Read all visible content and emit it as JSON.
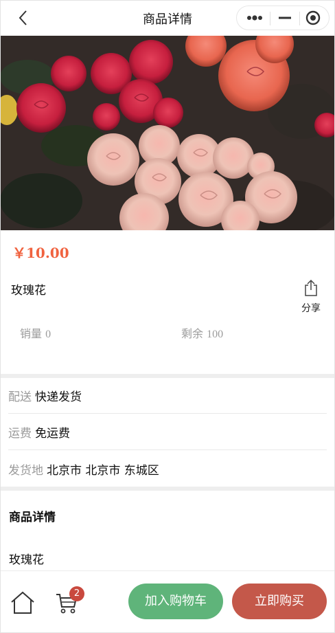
{
  "header": {
    "title": "商品详情",
    "icons": [
      "back-arrow-icon",
      "more-dots-icon",
      "minimize-icon",
      "target-close-icon"
    ]
  },
  "product": {
    "image_icon": "rose-bouquet-photo",
    "price": "￥10.00",
    "name": "玫瑰花",
    "share_label": "分享",
    "sales_label": "销量",
    "sales_value": "0",
    "stock_label": "剩余",
    "stock_value": "100"
  },
  "shipping": {
    "delivery_key": "配送",
    "delivery_value": "快递发货",
    "fee_key": "运费",
    "fee_value": "免运费",
    "origin_key": "发货地",
    "origin_value": "北京市 北京市 东城区"
  },
  "details": {
    "title": "商品详情",
    "body": "玫瑰花"
  },
  "bottom": {
    "cart_badge": "2",
    "add_to_cart": "加入购物车",
    "buy_now": "立即购买"
  },
  "colors": {
    "price": "#f0623f",
    "add_button": "#5fb47a",
    "buy_button": "#c4584a",
    "badge": "#c9493e"
  }
}
